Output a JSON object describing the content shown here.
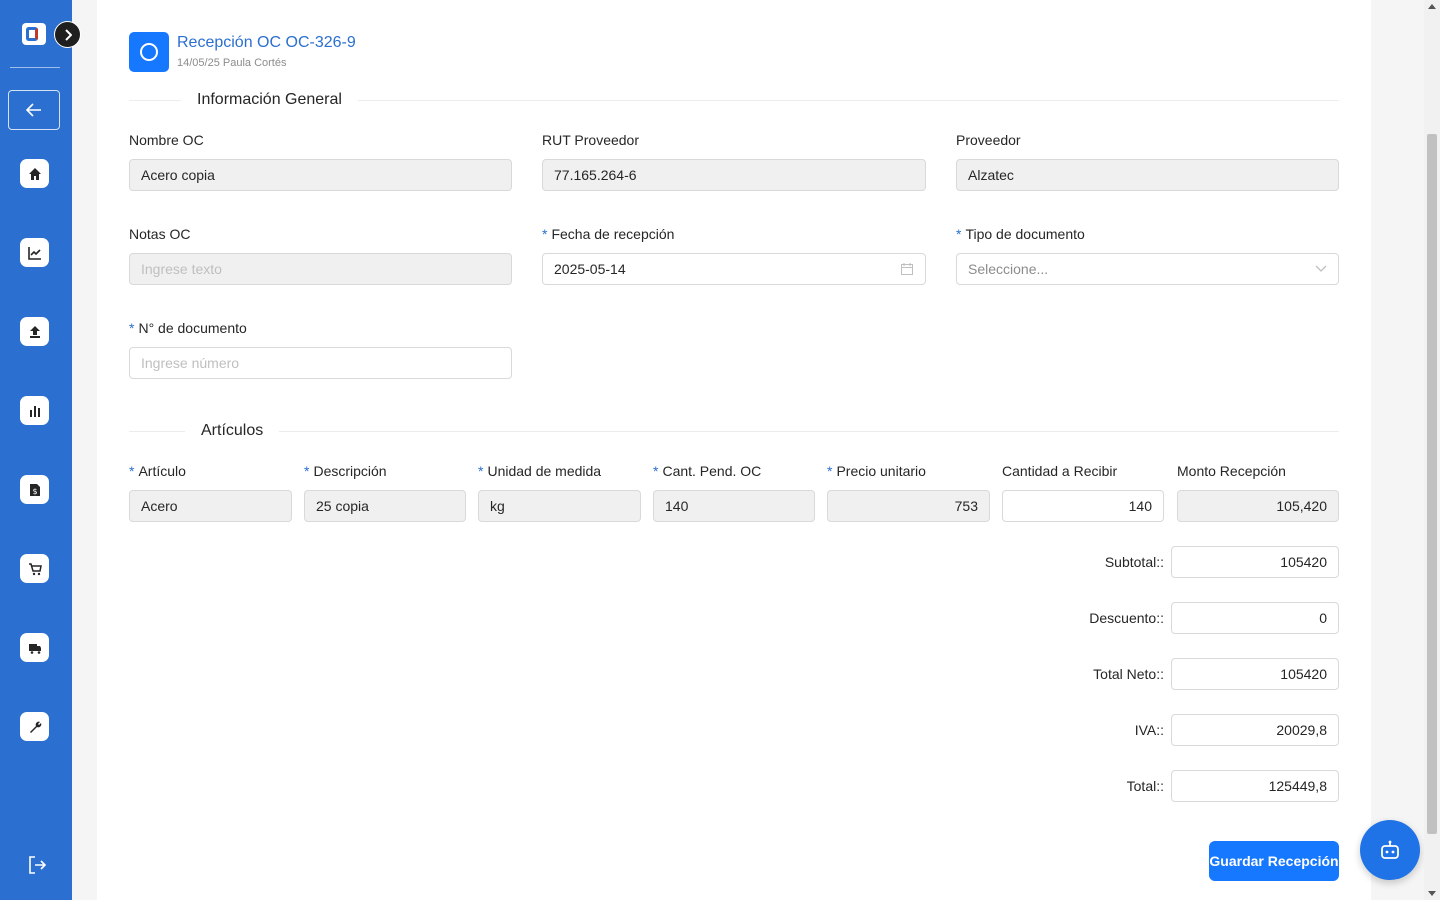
{
  "header": {
    "title": "Recepción OC OC-326-9",
    "subtitle": "14/05/25 Paula Cortés"
  },
  "sections": {
    "general": "Información General",
    "articulos": "Artículos"
  },
  "general": {
    "nombre_oc": {
      "label": "Nombre OC",
      "value": "Acero copia"
    },
    "rut_proveedor": {
      "label": "RUT Proveedor",
      "value": "77.165.264-6"
    },
    "proveedor": {
      "label": "Proveedor",
      "value": "Alzatec"
    },
    "notas_oc": {
      "label": "Notas OC",
      "placeholder": "Ingrese texto"
    },
    "fecha_recepcion": {
      "label": "Fecha de recepción",
      "value": "2025-05-14"
    },
    "tipo_documento": {
      "label": "Tipo de documento",
      "placeholder": "Seleccione..."
    },
    "num_documento": {
      "label": "N° de documento",
      "placeholder": "Ingrese número"
    }
  },
  "articulos": {
    "columns": {
      "articulo": "Artículo",
      "descripcion": "Descripción",
      "unidad": "Unidad de medida",
      "cant_pend": "Cant. Pend. OC",
      "precio": "Precio unitario",
      "cantidad_recibir": "Cantidad a Recibir",
      "monto": "Monto Recepción"
    },
    "row": {
      "articulo": "Acero",
      "descripcion": "25 copia",
      "unidad": "kg",
      "cant_pend": "140",
      "precio": "753",
      "cantidad_recibir": "140",
      "monto": "105,420"
    }
  },
  "totals": {
    "subtotal": {
      "label": "Subtotal::",
      "value": "105420"
    },
    "descuento": {
      "label": "Descuento::",
      "value": "0"
    },
    "total_neto": {
      "label": "Total Neto::",
      "value": "105420"
    },
    "iva": {
      "label": "IVA::",
      "value": "20029,8"
    },
    "total": {
      "label": "Total::",
      "value": "125449,8"
    }
  },
  "actions": {
    "save": "Guardar Recepción"
  },
  "colors": {
    "sidebar": "#2b6fd0",
    "primary": "#1677ff",
    "required_mark": "#2b6fd0"
  }
}
